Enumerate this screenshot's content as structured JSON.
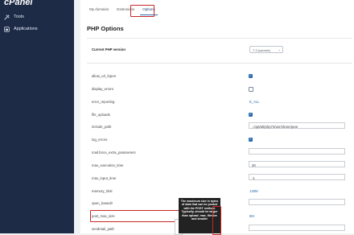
{
  "sidebar": {
    "logo": "cPanel",
    "items": [
      {
        "label": "Tools",
        "icon": "tools-icon"
      },
      {
        "label": "Applications",
        "icon": "applications-icon"
      }
    ]
  },
  "tabs": [
    {
      "label": "My domains",
      "active": false
    },
    {
      "label": "Extensions",
      "active": false
    },
    {
      "label": "Options",
      "active": true
    }
  ],
  "page": {
    "title": "PHP Options",
    "current_php_label": "Current PHP version",
    "current_php_value": "7.3 (current)"
  },
  "options": [
    {
      "name": "allow_url_fopen",
      "type": "checkbox",
      "checked": true
    },
    {
      "name": "display_errors",
      "type": "checkbox",
      "checked": false
    },
    {
      "name": "error_reporting",
      "type": "link",
      "value": "E_ALL"
    },
    {
      "name": "file_uploads",
      "type": "checkbox",
      "checked": true
    },
    {
      "name": "include_path",
      "type": "text",
      "value": ".:/opt/alt/php73/usr/share/pear"
    },
    {
      "name": "log_errors",
      "type": "checkbox",
      "checked": true
    },
    {
      "name": "mail.force_extra_parameters",
      "type": "text",
      "value": ""
    },
    {
      "name": "max_execution_time",
      "type": "text",
      "value": "30"
    },
    {
      "name": "max_input_time",
      "type": "text",
      "value": "-1"
    },
    {
      "name": "memory_limit",
      "type": "link",
      "value": "128M"
    },
    {
      "name": "open_basedir",
      "type": "text",
      "value": ""
    },
    {
      "name": "post_max_size",
      "type": "link",
      "value": "8M"
    },
    {
      "name": "sendmail_path",
      "type": "text",
      "value": ""
    }
  ],
  "tooltip": "The maximum size in bytes of data that can be posted with the POST method. Typically, should be larger than upload_max_filesize and smaller",
  "colors": {
    "sidebar": "#1d2b47",
    "accent": "#2b6cb0",
    "highlight": "#c62828"
  }
}
